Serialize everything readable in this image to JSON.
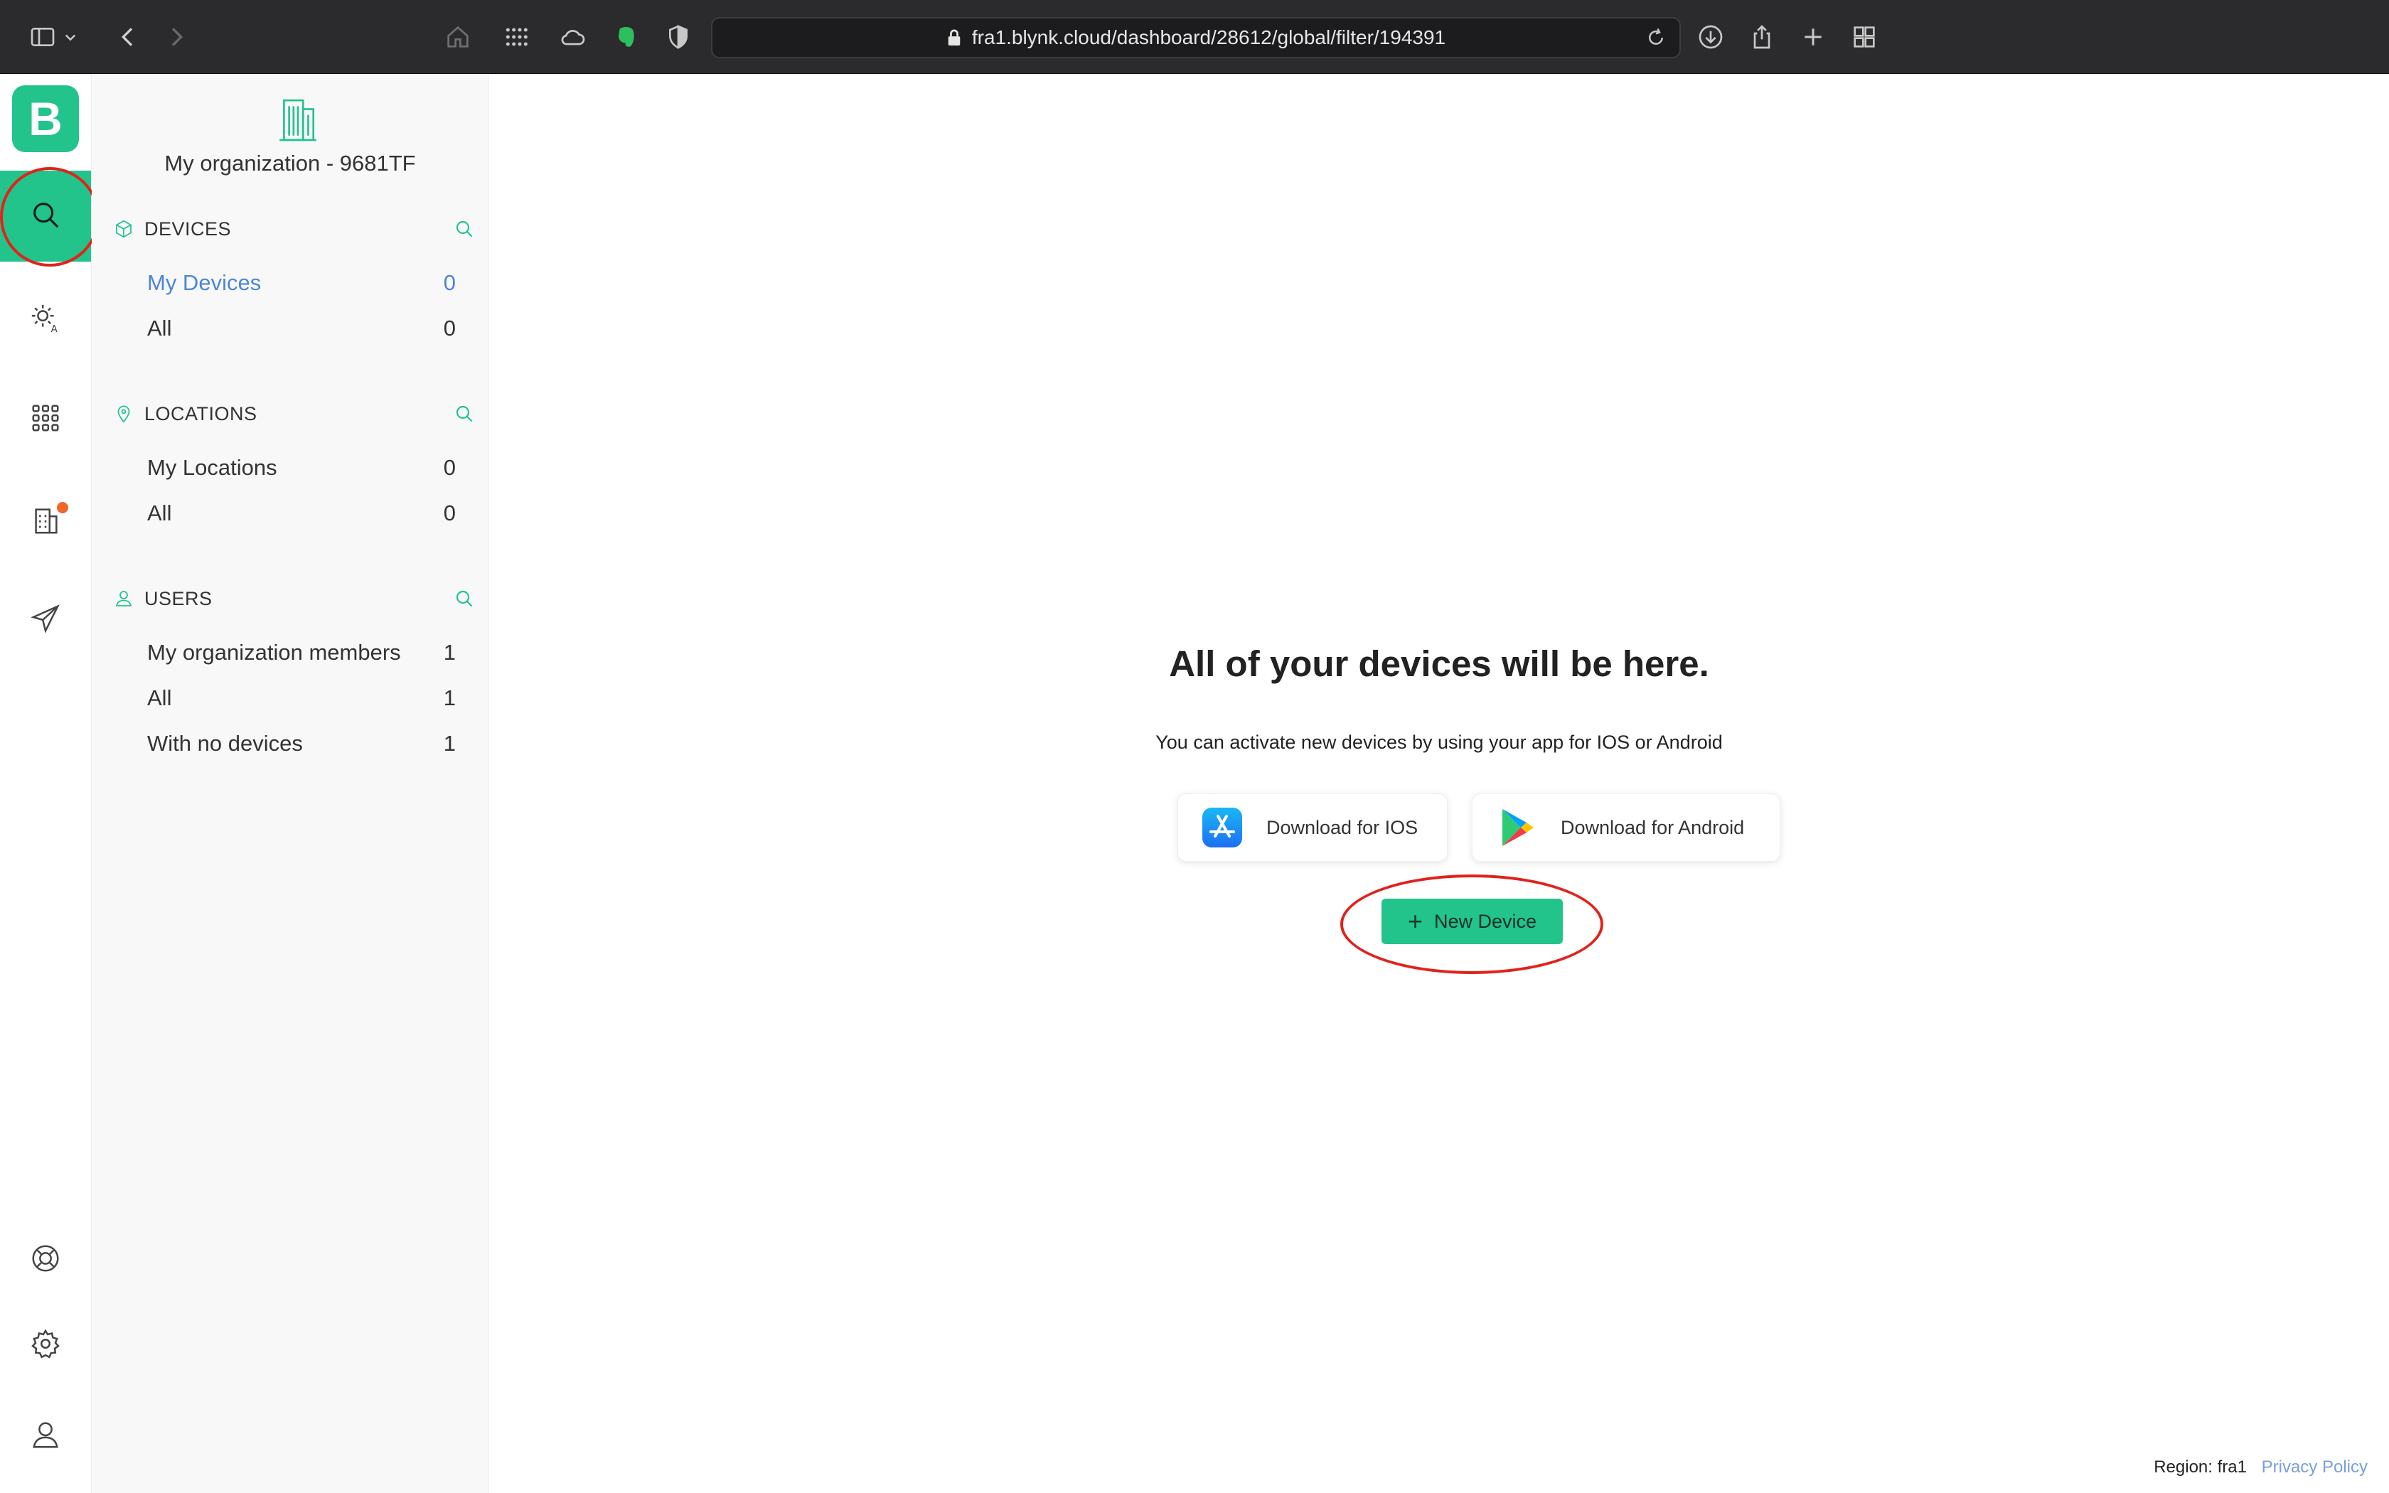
{
  "browser": {
    "url": "fra1.blynk.cloud/dashboard/28612/global/filter/194391"
  },
  "rail": {
    "logo_letter": "B"
  },
  "sidebar": {
    "org_name": "My organization - 9681TF",
    "sections": {
      "devices": {
        "title": "DEVICES",
        "items": [
          {
            "label": "My Devices",
            "count": "0"
          },
          {
            "label": "All",
            "count": "0"
          }
        ]
      },
      "locations": {
        "title": "LOCATIONS",
        "items": [
          {
            "label": "My Locations",
            "count": "0"
          },
          {
            "label": "All",
            "count": "0"
          }
        ]
      },
      "users": {
        "title": "USERS",
        "items": [
          {
            "label": "My organization members",
            "count": "1"
          },
          {
            "label": "All",
            "count": "1"
          },
          {
            "label": "With no devices",
            "count": "1"
          }
        ]
      }
    }
  },
  "main": {
    "empty_title": "All of your devices will be here.",
    "empty_subtitle": "You can activate new devices by using your app for IOS or Android",
    "ios_button": "Download for IOS",
    "android_button": "Download for Android",
    "new_device_button": "New Device"
  },
  "footer": {
    "region": "Region: fra1",
    "privacy": "Privacy Policy"
  },
  "colors": {
    "accent": "#23c38c",
    "active_link": "#4d86d6",
    "annotation": "#e0231b",
    "notification_dot": "#f0672c"
  }
}
